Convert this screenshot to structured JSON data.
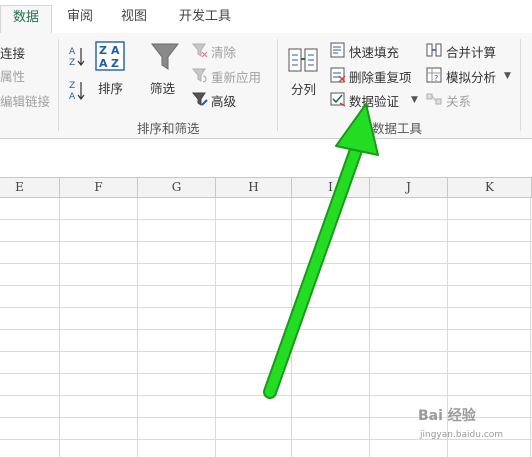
{
  "tabs": [
    {
      "label": "数据",
      "active": true
    },
    {
      "label": "审阅",
      "active": false
    },
    {
      "label": "视图",
      "active": false
    },
    {
      "label": "开发工具",
      "active": false
    }
  ],
  "connections": {
    "links": "连接",
    "properties": "属性",
    "edit_links": "编辑链接"
  },
  "sort_filter": {
    "sort": "排序",
    "filter": "筛选",
    "clear": "清除",
    "reapply": "重新应用",
    "advanced": "高级",
    "group_label": "排序和筛选"
  },
  "data_tools": {
    "split": "分列",
    "flash_fill": "快速填充",
    "remove_duplicates": "删除重复项",
    "data_validation": "数据验证",
    "consolidate": "合并计算",
    "what_if": "模拟分析",
    "relationships": "关系",
    "group_label": "数据工具"
  },
  "columns": [
    "E",
    "F",
    "G",
    "H",
    "I",
    "J",
    "K"
  ],
  "watermark": {
    "brand": "Bai 经验",
    "url": "jingyan.baidu.com"
  },
  "colors": {
    "accent": "#217346",
    "arrow": "#22dd22",
    "arrow_outline": "#1a9a1a"
  }
}
